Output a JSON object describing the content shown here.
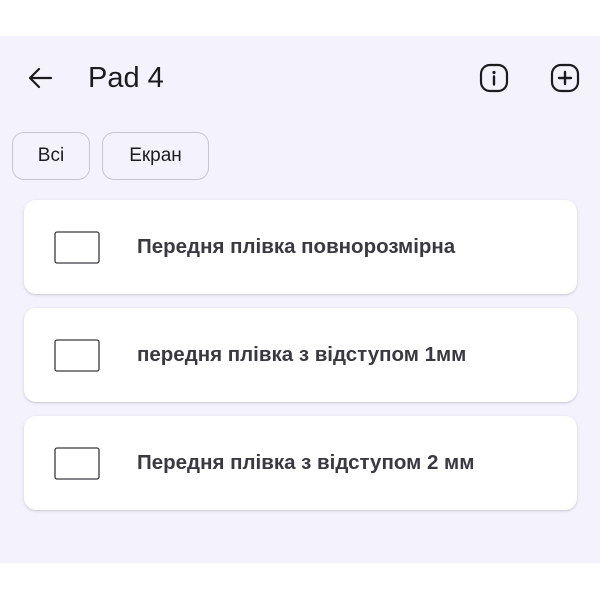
{
  "appbar": {
    "title": "Pad 4",
    "back_icon": "arrow-left-icon",
    "info_icon": "info-circle-icon",
    "add_icon": "add-square-icon"
  },
  "filters": {
    "chips": [
      {
        "label": "Всі"
      },
      {
        "label": "Екран"
      }
    ]
  },
  "items": [
    {
      "label": "Передня плівка повнорозмірна",
      "icon": "screen-frame-icon"
    },
    {
      "label": "передня плівка з відступом 1мм",
      "icon": "screen-frame-icon"
    },
    {
      "label": "Передня плівка з відступом 2 мм",
      "icon": "screen-frame-icon"
    }
  ],
  "colors": {
    "background": "#f4f2fc",
    "card": "#ffffff",
    "text": "#1c1b1f",
    "chip_border": "#c9c6d0"
  }
}
